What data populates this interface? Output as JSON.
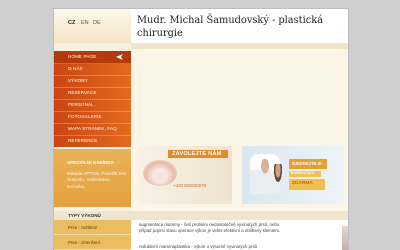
{
  "languages": [
    "CZ",
    "EN",
    "DE"
  ],
  "site_title": "Mudr. Michal Šamudovský - plastická chirurgie",
  "nav": {
    "items": [
      {
        "label": "HOME PAGE",
        "active": true
      },
      {
        "label": "O NÁS",
        "active": false
      },
      {
        "label": "VÝKONY",
        "active": false
      },
      {
        "label": "REZERVACE",
        "active": false
      },
      {
        "label": "PERSONÁL",
        "active": false
      },
      {
        "label": "FOTOGALERIE",
        "active": false
      },
      {
        "label": "MAPA STRÁNEK, FAQ",
        "active": false
      },
      {
        "label": "REFERENCE",
        "active": false
      }
    ]
  },
  "special": {
    "title": "SPECIÁLNÍ NABÍDKA",
    "body": "Metoda APTOS. Faceliftt bez skalpelu. Vidět krásu technika."
  },
  "banners": {
    "call_us": "ZAVOLEJTE NÁM",
    "phone": "+420 602630079",
    "promo_line1": "SJEDNEJTE SI",
    "promo_line2": "KONZULTACI",
    "promo_line3": "ZDARMA"
  },
  "types_header": "TYPY VÝKONŮ",
  "type_items": [
    "Prsa - zvětšení",
    "Prsa - zmenšení"
  ],
  "paragraphs": [
    "augmentace mammy - četí problém nedostatečně vyvinutých prsů, nebo případ poprsí stavu operace výkon je velmi efektivní a oblíbený klientem.",
    "reduktivní mammaplastika - výkon u výrazně vyvinutých prsů"
  ],
  "colors": {
    "nav_orange": "#d9571a",
    "accent_gold": "#e6b24f"
  }
}
